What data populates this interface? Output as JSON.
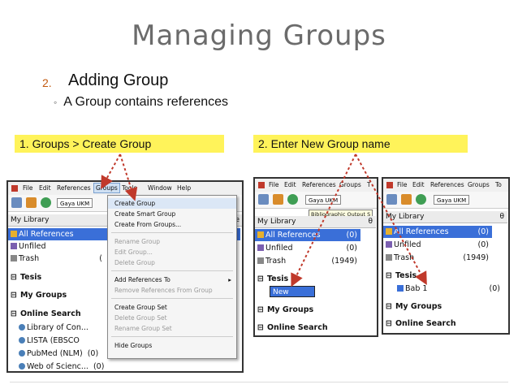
{
  "slide": {
    "title": "Managing Groups",
    "point_number": "2.",
    "point_text": "Adding Group",
    "subpoint_bullet": "◦",
    "subpoint_text": "A Group contains references"
  },
  "callouts": {
    "left": "1. Groups > Create Group",
    "right": "2. Enter New Group name"
  },
  "shot1": {
    "menubar": [
      "File",
      "Edit",
      "References",
      "Groups",
      "Tools",
      "Window",
      "Help"
    ],
    "style_box": "Gaya UKM",
    "library_header": "My Library",
    "library_header_suffix": "e",
    "rows": [
      {
        "label": "All References",
        "count": ""
      },
      {
        "label": "Unfiled",
        "count": ""
      },
      {
        "label": "Trash",
        "count": "("
      }
    ],
    "groups": [
      {
        "label": "Tesis"
      },
      {
        "label": "My Groups"
      },
      {
        "label": "Online Search"
      }
    ],
    "online": [
      {
        "label": "Library of Con...",
        "count": ""
      },
      {
        "label": "LISTA (EBSCO",
        "count": ""
      },
      {
        "label": "PubMed (NLM)",
        "count": "(0)"
      },
      {
        "label": "Web of Scienc...",
        "count": "(0)"
      }
    ],
    "groups_menu": [
      {
        "label": "Create Group",
        "enabled": true
      },
      {
        "label": "Create Smart Group",
        "enabled": true
      },
      {
        "label": "Create From Groups...",
        "enabled": true
      },
      {
        "label": "Rename Group",
        "enabled": false
      },
      {
        "label": "Edit Group...",
        "enabled": false
      },
      {
        "label": "Delete Group",
        "enabled": false
      },
      {
        "label": "Add References To",
        "enabled": true
      },
      {
        "label": "Remove References From Group",
        "enabled": false
      },
      {
        "label": "Create Group Set",
        "enabled": true
      },
      {
        "label": "Delete Group Set",
        "enabled": false
      },
      {
        "label": "Rename Group Set",
        "enabled": false
      },
      {
        "label": "Hide Groups",
        "enabled": true
      }
    ],
    "submenu_arrow": "▸"
  },
  "shot2": {
    "menubar": [
      "File",
      "Edit",
      "References",
      "Groups",
      "T"
    ],
    "style_box": "Gaya UKM",
    "tooltip": "Bibliographic Output S",
    "library_header": "My Library",
    "library_header_suffix": "θ",
    "rows": [
      {
        "label": "All References",
        "count": "(0)"
      },
      {
        "label": "Unfiled",
        "count": "(0)"
      },
      {
        "label": "Trash",
        "count": "(1949)"
      }
    ],
    "tesis": "Tesis",
    "new_group": "New Group",
    "my_groups": "My Groups",
    "online_search": "Online Search"
  },
  "shot3": {
    "menubar": [
      "File",
      "Edit",
      "References",
      "Groups",
      "To"
    ],
    "style_box": "Gaya UKM",
    "library_header": "My Library",
    "library_header_suffix": "θ",
    "rows": [
      {
        "label": "All References",
        "count": "(0)"
      },
      {
        "label": "Unfiled",
        "count": "(0)"
      },
      {
        "label": "Trash",
        "count": "(1949)"
      }
    ],
    "tesis": "Tesis",
    "bab": {
      "label": "Bab 1",
      "count": "(0)"
    },
    "my_groups": "My Groups",
    "online_search": "Online Search"
  },
  "colors": {
    "callout": "#fff35a",
    "selection": "#3a6fd8",
    "arrow": "#c0392b",
    "title": "#6b6b6b"
  }
}
